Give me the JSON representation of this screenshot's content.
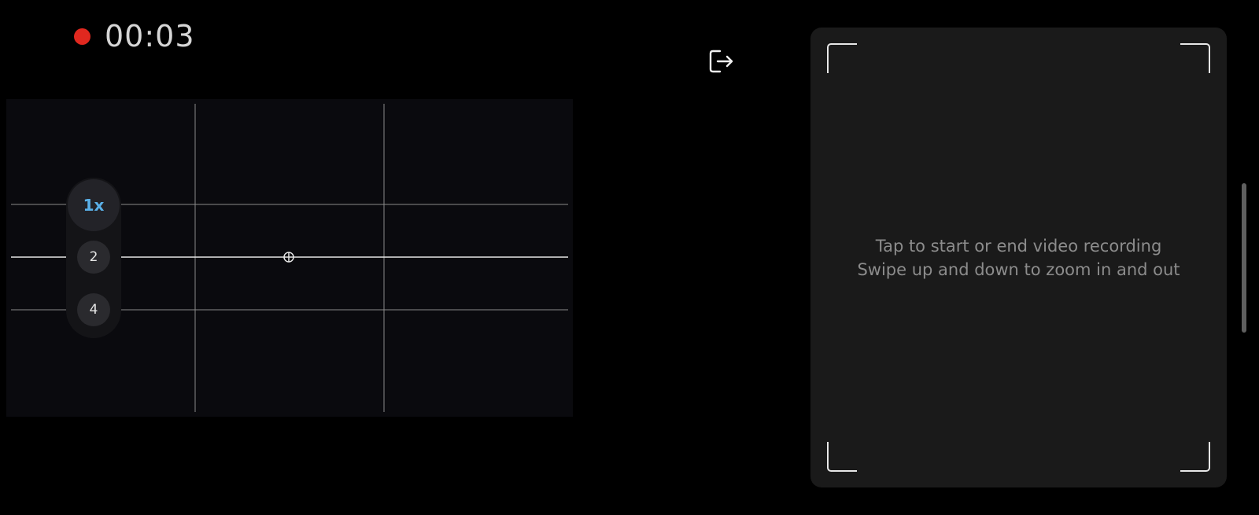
{
  "recording": {
    "time": "00:03",
    "indicator_color": "#e0281f"
  },
  "zoom": {
    "options": [
      {
        "label": "1x",
        "active": true
      },
      {
        "label": "2",
        "active": false
      },
      {
        "label": "4",
        "active": false
      }
    ],
    "active_color": "#5ab0e8"
  },
  "exit": {
    "icon": "exit-icon"
  },
  "viewfinder": {
    "grid": "rule-of-thirds",
    "icons": [
      "crosshair-icon"
    ]
  },
  "touchpad": {
    "hint_line1": "Tap to start or end video recording",
    "hint_line2": "Swipe up and down to zoom in and out"
  }
}
